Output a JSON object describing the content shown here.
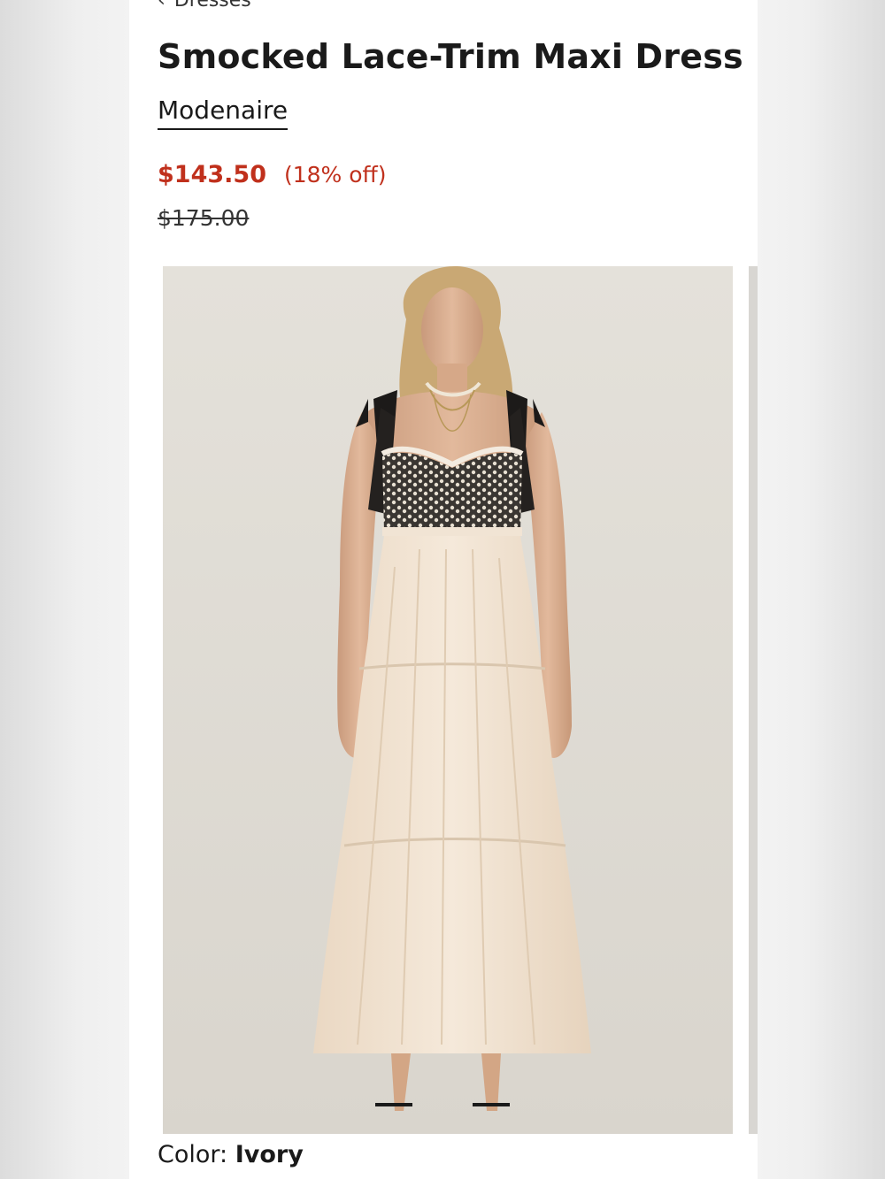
{
  "breadcrumb": {
    "label": "Dresses"
  },
  "product": {
    "title": "Smocked Lace-Trim Maxi Dress",
    "brand": "Modenaire",
    "sale_price": "$143.50",
    "discount": "(18% off)",
    "original_price": "$175.00",
    "color_label": "Color:",
    "color_value": "Ivory"
  },
  "colors": {
    "sale": "#c0301c",
    "text": "#1a1a1a",
    "photo_bg": "#ddd9d1",
    "dress": "#f1e4d4"
  },
  "icons": {
    "back": "chevron-left-icon"
  }
}
